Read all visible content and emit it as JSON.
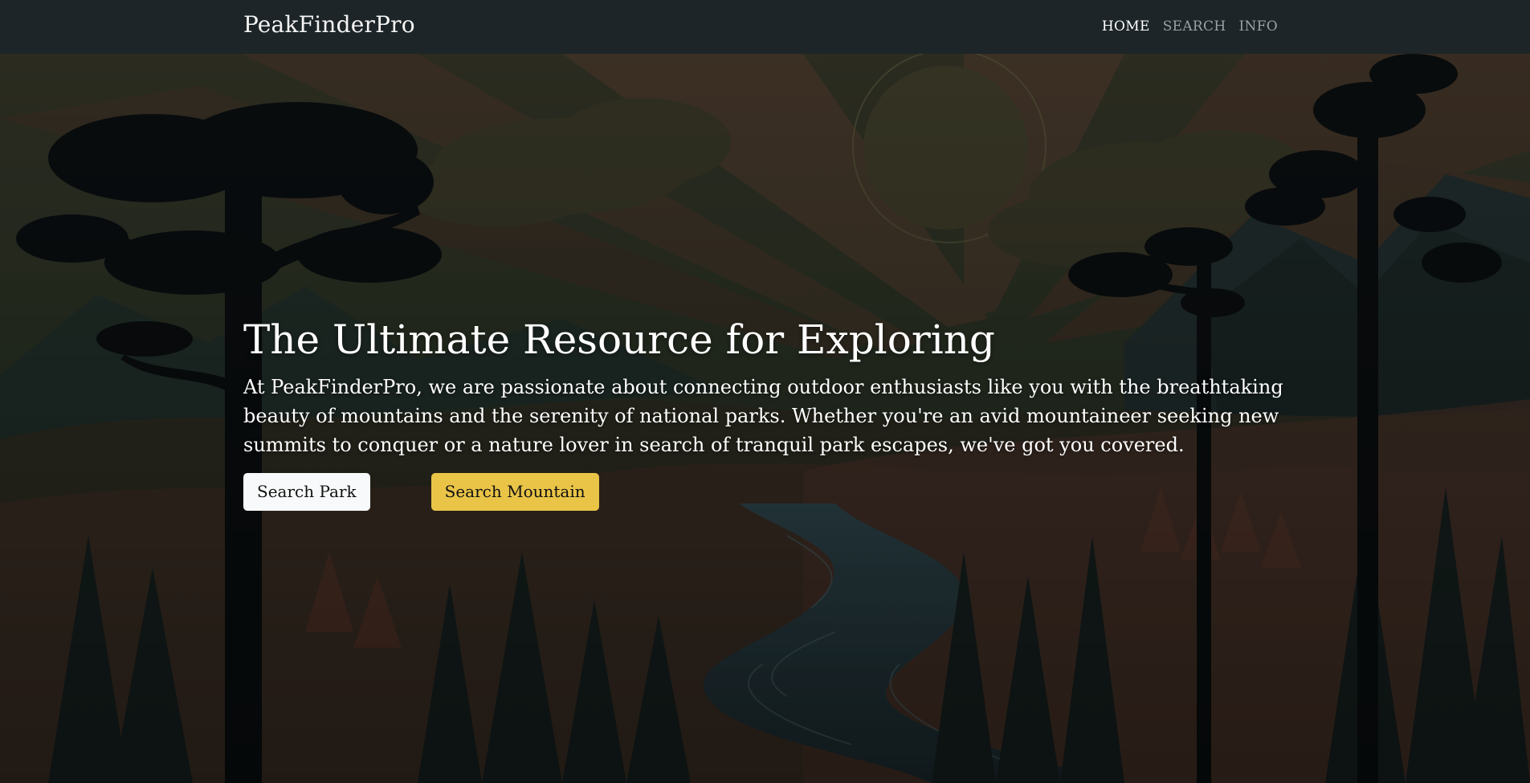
{
  "navbar": {
    "brand": "PeakFinderPro",
    "links": [
      {
        "label": "HOME"
      },
      {
        "label": "SEARCH"
      },
      {
        "label": "INFO"
      }
    ]
  },
  "hero": {
    "title": "The Ultimate Resource for Exploring",
    "text": "At PeakFinderPro, we are passionate about connecting outdoor enthusiasts like you with the breathtaking beauty of mountains and the serenity of national parks. Whether you're an avid mountaineer seeking new summits to conquer or a nature lover in search of tranquil park escapes, we've got you covered.",
    "buttons": {
      "search_park": "Search Park",
      "search_mountain": "Search Mountain"
    }
  },
  "colors": {
    "navbar_bg": "#1d2528",
    "accent_yellow": "#e9c447",
    "button_light": "#f8f9fa"
  }
}
